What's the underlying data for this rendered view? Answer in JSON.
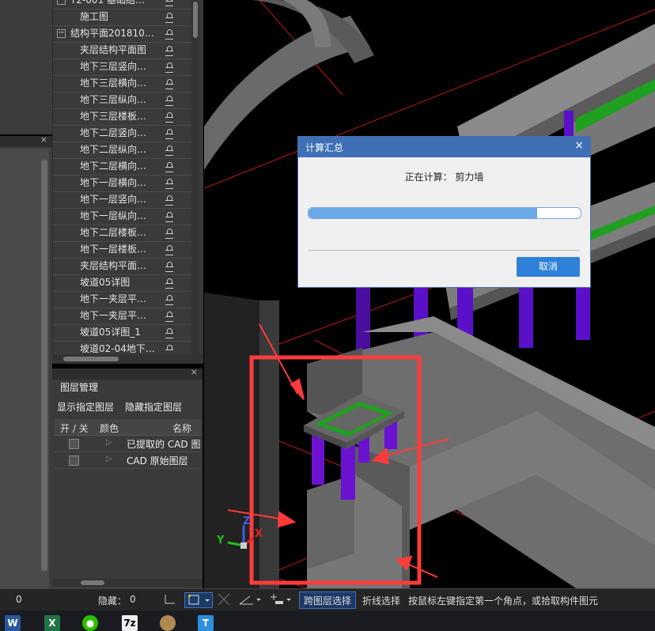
{
  "tree": {
    "items": [
      {
        "label": "T2-001 基础结…",
        "level": 0,
        "expander": "−"
      },
      {
        "label": "施工图",
        "level": 1
      },
      {
        "label": "结构平面201810…",
        "level": 0,
        "expander": "−"
      },
      {
        "label": "夹层结构平面图",
        "level": 1
      },
      {
        "label": "地下三层竖向…",
        "level": 1
      },
      {
        "label": "地下三层横向…",
        "level": 1
      },
      {
        "label": "地下三层纵向…",
        "level": 1
      },
      {
        "label": "地下三层楼板…",
        "level": 1
      },
      {
        "label": "地下二层竖向…",
        "level": 1
      },
      {
        "label": "地下二层纵向…",
        "level": 1
      },
      {
        "label": "地下二层横向…",
        "level": 1
      },
      {
        "label": "地下一层横向…",
        "level": 1
      },
      {
        "label": "地下一层竖向…",
        "level": 1
      },
      {
        "label": "地下一层纵向…",
        "level": 1
      },
      {
        "label": "地下二层楼板…",
        "level": 1
      },
      {
        "label": "地下一层楼板…",
        "level": 1
      },
      {
        "label": "夹层结构平面…",
        "level": 1
      },
      {
        "label": "坡道05详图",
        "level": 1
      },
      {
        "label": "地下一夹层平…",
        "level": 1
      },
      {
        "label": "地下一夹层平…",
        "level": 1
      },
      {
        "label": "坡道05详图_1",
        "level": 1
      },
      {
        "label": "坡道02-04地下…",
        "level": 1
      }
    ]
  },
  "layer_panel": {
    "title": "图层管理",
    "show_btn": "显示指定图层",
    "hide_btn": "隐藏指定图层",
    "headers": {
      "onoff": "开 / 关",
      "color": "颜色",
      "name": "名称"
    },
    "rows": [
      {
        "name": "已提取的 CAD 图"
      },
      {
        "name": "CAD 原始图层"
      }
    ]
  },
  "dialog": {
    "title": "计算汇总",
    "close": "×",
    "status": "正在计算：  剪力墙",
    "progress": 0.84,
    "cancel": "取消"
  },
  "statusbar": {
    "left_value": "0",
    "hidden_label": "隐藏：",
    "hidden_value": "0",
    "cross_layer": "跨图层选择",
    "polyline_select": "折线选择",
    "hint": "按鼠标左键指定第一个角点，或拾取构件图元"
  },
  "axes": {
    "x": "X",
    "y": "Y",
    "z": "Z"
  },
  "colors": {
    "accent": "#3f70b5",
    "column": "#5a10c8",
    "rebar": "#1fa01f",
    "annotation": "#ff3b3b"
  },
  "taskbar": {
    "icons": [
      "word-icon",
      "excel-icon",
      "wechat-icon",
      "7zip-icon",
      "pet-icon",
      "t-app-icon"
    ]
  }
}
